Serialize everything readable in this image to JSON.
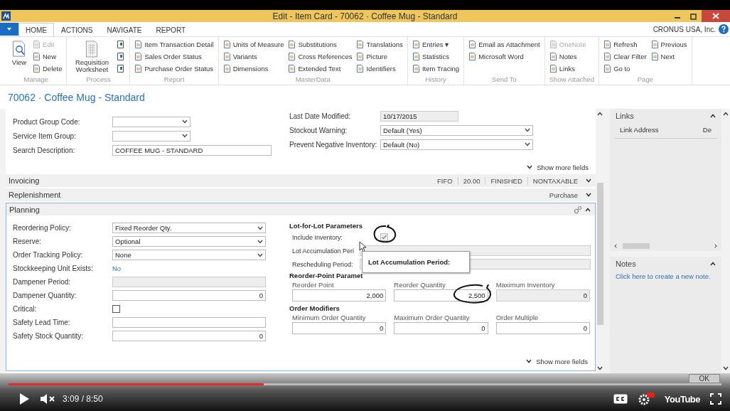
{
  "window": {
    "title": "Edit - Item Card - 70062 · Coffee Mug - Standard"
  },
  "ribbon_tabs": [
    {
      "label": "HOME",
      "selected": true
    },
    {
      "label": "ACTIONS",
      "selected": false
    },
    {
      "label": "NAVIGATE",
      "selected": false
    },
    {
      "label": "REPORT",
      "selected": false
    }
  ],
  "company": "CRONUS USA, Inc.",
  "ribbon_groups": [
    {
      "name": "Manage",
      "large": {
        "kind": "view",
        "label": "View"
      },
      "columns": [
        {
          "kind": "labeled",
          "items": [
            {
              "label": "Edit",
              "disabled": true
            },
            {
              "label": "New",
              "disabled": false
            },
            {
              "label": "Delete",
              "disabled": false
            }
          ]
        }
      ]
    },
    {
      "name": "Process",
      "large": {
        "kind": "worksheet",
        "label": "Requisition Worksheet"
      },
      "columns": [
        {
          "kind": "icons",
          "items": [
            {
              "disabled": false
            },
            {
              "disabled": false
            },
            {
              "disabled": false
            }
          ]
        }
      ]
    },
    {
      "name": "Report",
      "columns": [
        {
          "kind": "labeled",
          "items": [
            {
              "label": "Item Transaction Detail",
              "disabled": false
            },
            {
              "label": "Sales Order Status",
              "disabled": false
            },
            {
              "label": "Purchase Order Status",
              "disabled": false
            }
          ]
        }
      ]
    },
    {
      "name": "MasterData",
      "columns": [
        {
          "kind": "labeled",
          "items": [
            {
              "label": "Units of Measure",
              "disabled": false
            },
            {
              "label": "Variants",
              "disabled": false
            },
            {
              "label": "Dimensions",
              "disabled": false
            }
          ]
        },
        {
          "kind": "labeled",
          "items": [
            {
              "label": "Substitutions",
              "disabled": false
            },
            {
              "label": "Cross References",
              "disabled": false
            },
            {
              "label": "Extended Text",
              "disabled": false
            }
          ]
        },
        {
          "kind": "labeled",
          "items": [
            {
              "label": "Translations",
              "disabled": false
            },
            {
              "label": "Picture",
              "disabled": false
            },
            {
              "label": "Identifiers",
              "disabled": false
            }
          ]
        }
      ]
    },
    {
      "name": "History",
      "columns": [
        {
          "kind": "labeled",
          "items": [
            {
              "label": "Entries ▾",
              "disabled": false
            },
            {
              "label": "Statistics",
              "disabled": false
            },
            {
              "label": "Item Tracing",
              "disabled": false
            }
          ]
        }
      ]
    },
    {
      "name": "Send To",
      "columns": [
        {
          "kind": "labeled",
          "items": [
            {
              "label": "Email as Attachment",
              "disabled": false
            },
            {
              "label": "Microsoft Word",
              "disabled": false
            }
          ]
        }
      ]
    },
    {
      "name": "Show Attached",
      "columns": [
        {
          "kind": "labeled",
          "items": [
            {
              "label": "OneNote",
              "disabled": true
            },
            {
              "label": "Notes",
              "disabled": false
            },
            {
              "label": "Links",
              "disabled": false
            }
          ]
        }
      ]
    },
    {
      "name": "Page",
      "columns": [
        {
          "kind": "labeled",
          "items": [
            {
              "label": "Refresh",
              "disabled": false
            },
            {
              "label": "Clear Filter",
              "disabled": false
            },
            {
              "label": "Go to",
              "disabled": false
            }
          ]
        },
        {
          "kind": "labeled",
          "items": [
            {
              "label": "Previous",
              "disabled": false
            },
            {
              "label": "Next",
              "disabled": false
            }
          ]
        }
      ]
    }
  ],
  "page_title": "70062 · Coffee Mug - Standard",
  "general": {
    "left": [
      {
        "label": "Product Group Code:",
        "kind": "dropdown"
      },
      {
        "label": "Service Item Group:",
        "kind": "dropdown"
      },
      {
        "label": "Search Description:",
        "kind": "text",
        "value": "COFFEE MUG - STANDARD"
      }
    ],
    "right": [
      {
        "label": "Last Date Modified:",
        "kind": "readonly",
        "value": "10/17/2015"
      },
      {
        "label": "Stockout Warning:",
        "kind": "dropdown",
        "value": "Default (Yes)"
      },
      {
        "label": "Prevent Negative Inventory:",
        "kind": "dropdown",
        "value": "Default (No)"
      }
    ],
    "show_more": "Show more fields"
  },
  "fasttabs": [
    {
      "title": "Invoicing",
      "expanded": false,
      "summary": [
        "FIFO",
        "20.00",
        "FINISHED",
        "NONTAXABLE"
      ]
    },
    {
      "title": "Replenishment",
      "expanded": false,
      "summary": [
        "Purchase"
      ]
    },
    {
      "title": "Planning",
      "expanded": true
    }
  ],
  "planning": {
    "left": [
      {
        "label": "Reordering Policy:",
        "kind": "dropdown",
        "value": "Fixed Reorder Qty."
      },
      {
        "label": "Reserve:",
        "kind": "dropdown",
        "value": "Optional"
      },
      {
        "label": "Order Tracking Policy:",
        "kind": "dropdown",
        "value": "None"
      },
      {
        "label": "Stockkeeping Unit Exists:",
        "kind": "link",
        "value": "No"
      },
      {
        "label": "Dampener Period:",
        "kind": "readonly"
      },
      {
        "label": "Dampener Quantity:",
        "kind": "number",
        "value": "0"
      },
      {
        "label": "Critical:",
        "kind": "checkbox",
        "checked": false,
        "disabled": false
      },
      {
        "label": "Safety Lead Time:",
        "kind": "text"
      },
      {
        "label": "Safety Stock Quantity:",
        "kind": "number",
        "value": "0"
      }
    ],
    "groups": [
      {
        "title": "Lot-for-Lot Parameters",
        "kind": "rows",
        "fields": [
          {
            "label": "Include Inventory:",
            "kind": "checkbox",
            "checked": true,
            "disabled": true
          },
          {
            "label": "Lot Accumulation Peri",
            "kind": "readonly"
          },
          {
            "label": "Rescheduling Period:",
            "kind": "readonly"
          }
        ]
      },
      {
        "title": "Reorder-Point Paramet",
        "kind": "columns",
        "fields": [
          {
            "label": "Reorder Point",
            "kind": "number",
            "value": "2,000"
          },
          {
            "label": "Reorder Quantity",
            "kind": "number",
            "value": "2,500"
          },
          {
            "label": "Maximum Inventory",
            "kind": "readonly_number",
            "value": "0"
          }
        ]
      },
      {
        "title": "Order Modifiers",
        "kind": "columns",
        "fields": [
          {
            "label": "Minimum Order Quantity",
            "kind": "number",
            "value": "0"
          },
          {
            "label": "Maximum Order Quantity",
            "kind": "number",
            "value": "0"
          },
          {
            "label": "Order Multiple",
            "kind": "number",
            "value": "0"
          }
        ]
      }
    ],
    "tooltip": "Lot Accumulation Period:",
    "show_more": "Show more fields"
  },
  "factbox": {
    "links": {
      "title": "Links",
      "columns": [
        "Link Address",
        "De"
      ]
    },
    "notes": {
      "title": "Notes",
      "link": "Click here to create a new note."
    }
  },
  "video": {
    "level": 0.358,
    "time": "3:09 / 8:50",
    "logo": "YouTube",
    "behind_button": "OK"
  }
}
